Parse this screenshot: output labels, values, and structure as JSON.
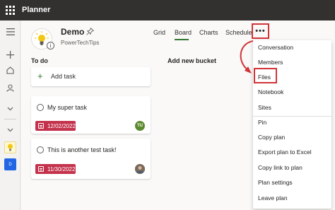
{
  "app": {
    "title": "Planner"
  },
  "rail": {
    "icons": [
      "hamburger-icon",
      "plus-icon",
      "home-icon",
      "person-icon",
      "chevron-down-icon",
      "chevron-down-icon"
    ],
    "plan_badge_initial": "D"
  },
  "plan": {
    "name": "Demo",
    "group": "PowerTechTips"
  },
  "tabs": [
    {
      "label": "Grid",
      "active": false
    },
    {
      "label": "Board",
      "active": true
    },
    {
      "label": "Charts",
      "active": false
    },
    {
      "label": "Schedule",
      "active": false
    }
  ],
  "more_button": {
    "label": "•••"
  },
  "buckets": {
    "todo": {
      "title": "To do",
      "add_task_label": "Add task",
      "tasks": [
        {
          "title": "My super task",
          "due": "12/02/2022",
          "assignee_initials": "TU",
          "assignee_color": "#5c8a2e"
        },
        {
          "title": "This is another test task!",
          "due": "11/30/2022",
          "assignee_initials": "",
          "assignee_color": "#6b5a4a"
        }
      ]
    },
    "new_bucket": {
      "label": "Add new bucket"
    }
  },
  "menu": {
    "items": [
      "Conversation",
      "Members",
      "Files",
      "Notebook",
      "Sites",
      "Pin",
      "Copy plan",
      "Export plan to Excel",
      "Copy link to plan",
      "Plan settings",
      "Leave plan"
    ],
    "highlighted": "Files"
  },
  "colors": {
    "topbar": "#323130",
    "accent": "#31752f",
    "overdue": "#c4314b",
    "highlight": "#d13438"
  }
}
